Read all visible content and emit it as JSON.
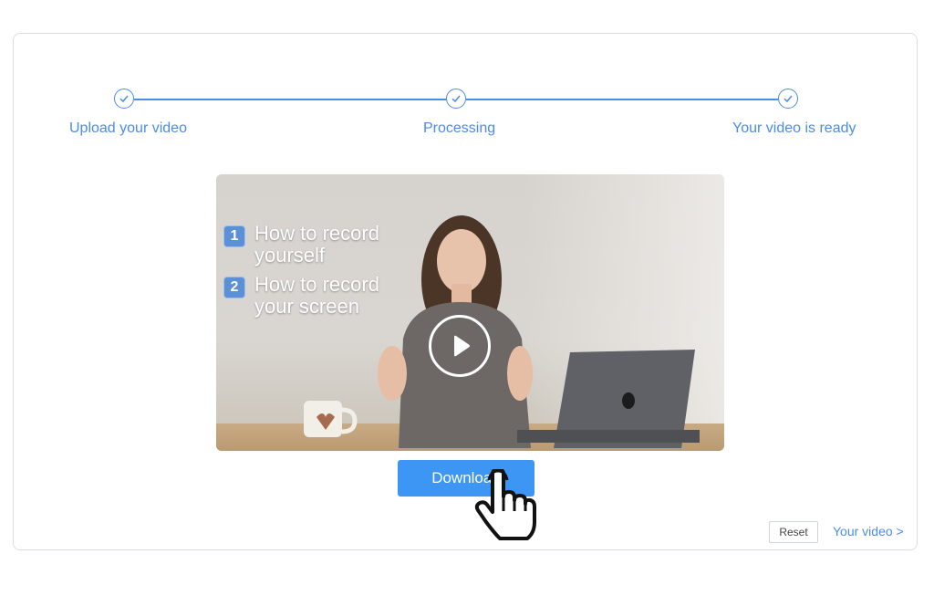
{
  "steps": [
    {
      "label": "Upload your video",
      "icon": "check-icon"
    },
    {
      "label": "Processing",
      "icon": "check-icon"
    },
    {
      "label": "Your video is ready",
      "icon": "check-icon"
    }
  ],
  "video": {
    "items": [
      {
        "number": "1",
        "text": "How to record yourself"
      },
      {
        "number": "2",
        "text": "How to record your screen"
      }
    ],
    "play_icon": "play-icon"
  },
  "actions": {
    "download_label": "Download",
    "reset_label": "Reset",
    "your_video_link": "Your video >"
  },
  "colors": {
    "accent": "#4a8de8",
    "button": "#3d96f4"
  },
  "cursor_icon": "hand-pointer-icon"
}
